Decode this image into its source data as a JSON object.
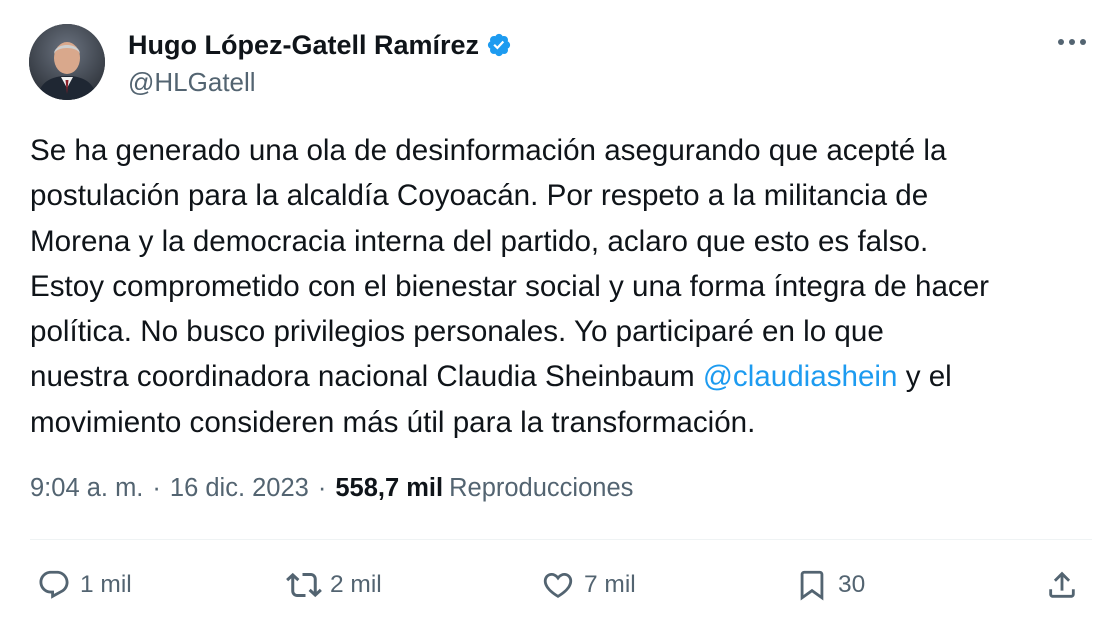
{
  "author": {
    "display_name": "Hugo López-Gatell Ramírez",
    "handle": "@HLGatell",
    "verified": true,
    "verified_color": "#1d9bf0"
  },
  "tweet": {
    "lines": [
      "Se ha generado una ola de desinformación asegurando que acepté la",
      "postulación para la alcaldía Coyoacán. Por respeto a la militancia de",
      "Morena y la democracia interna del partido, aclaro que esto es falso.",
      "Estoy comprometido con el bienestar social y una forma íntegra de hacer",
      "política. No busco privilegios personales. Yo participaré en lo que"
    ],
    "line6_before": "nuestra coordinadora nacional Claudia Sheinbaum ",
    "mention": "@claudiashein",
    "line6_after": " y el",
    "line7": "movimiento consideren más útil para la transformación."
  },
  "meta": {
    "time": "9:04 a. m.",
    "separator": "·",
    "date": "16 dic. 2023",
    "views_count": "558,7 mil",
    "views_label": "Reproducciones"
  },
  "actions": {
    "replies": "1 mil",
    "retweets": "2 mil",
    "likes": "7 mil",
    "bookmarks": "30"
  },
  "icons": {
    "more": "more-options-icon",
    "reply": "reply-icon",
    "retweet": "retweet-icon",
    "like": "heart-icon",
    "bookmark": "bookmark-icon",
    "share": "share-icon"
  },
  "colors": {
    "text": "#0f1419",
    "secondary": "#536471",
    "link": "#1d9bf0",
    "divider": "#eff3f4"
  }
}
